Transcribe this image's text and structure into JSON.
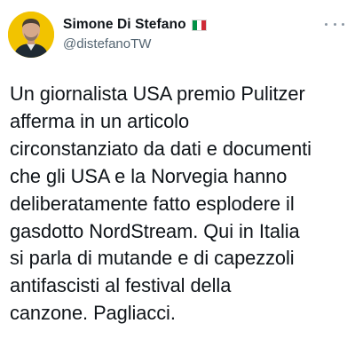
{
  "author": {
    "display_name": "Simone Di Stefano",
    "handle": "@distefanoTW",
    "flag_icon": "italian-flag-icon",
    "flag_colors": [
      "#009246",
      "#ffffff",
      "#ce2b37"
    ],
    "avatar_ring_color": "#f2c300"
  },
  "menu": {
    "icon": "more-options-icon"
  },
  "tweet": {
    "text": "Un giornalista USA premio Pulitzer\nafferma in un articolo\ncirconstanziato da dati e documenti\nche gli USA e la Norvegia hanno\ndeliberatamente fatto esplodere il\ngasdotto NordStream. Qui in Italia\nsi parla di mutande e di capezzoli\nantifascisti al festival della\ncanzone. Pagliacci."
  }
}
